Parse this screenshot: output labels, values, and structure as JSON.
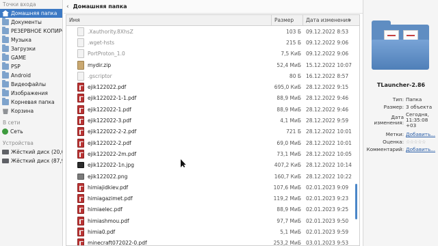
{
  "sidebar": {
    "sections": {
      "places": "Точки входа",
      "network": "В сети",
      "devices": "Устройства"
    },
    "places": [
      {
        "label": "Домашняя папка",
        "icon": "home-icon",
        "active": true
      },
      {
        "label": "Документы",
        "icon": "folder-icon"
      },
      {
        "label": "РЕЗЕРВНОЕ КОПИРОВ",
        "icon": "folder-icon"
      },
      {
        "label": "Музыка",
        "icon": "folder-icon"
      },
      {
        "label": "Загрузки",
        "icon": "folder-icon"
      },
      {
        "label": "GAME",
        "icon": "folder-icon"
      },
      {
        "label": "PSP",
        "icon": "folder-icon"
      },
      {
        "label": "Android",
        "icon": "folder-icon"
      },
      {
        "label": "Видеофайлы",
        "icon": "folder-icon"
      },
      {
        "label": "Изображения",
        "icon": "folder-icon"
      },
      {
        "label": "Корневая папка",
        "icon": "folder-icon"
      },
      {
        "label": "Корзина",
        "icon": "trash-icon"
      }
    ],
    "network": [
      {
        "label": "Сеть",
        "icon": "network-icon"
      }
    ],
    "devices": [
      {
        "label": "Жёсткий диск (20,0 Г",
        "icon": "disk-icon"
      },
      {
        "label": "Жёсткий диск (87,9 Г",
        "icon": "disk-icon"
      }
    ]
  },
  "location": {
    "back_arrow": "‹",
    "title": "Домашняя папка"
  },
  "table": {
    "columns": {
      "name": "Имя",
      "size": "Размер",
      "date": "Дата изменения",
      "sort_arrow": "▾"
    },
    "rows": [
      {
        "name": ".Xauthority.8XhsZ",
        "size": "103 Б",
        "date": "09.12.2022 8:53",
        "type": "doc",
        "hidden": true
      },
      {
        "name": ".wget-hsts",
        "size": "215 Б",
        "date": "09.12.2022 9:06",
        "type": "doc",
        "hidden": true
      },
      {
        "name": "PortProton_1.0",
        "size": "7,5 КиБ",
        "date": "09.12.2022 9:06",
        "type": "doc",
        "hidden": true
      },
      {
        "name": "mydir.zip",
        "size": "52,4 МиБ",
        "date": "15.12.2022 10:07",
        "type": "zip",
        "hidden": false
      },
      {
        "name": ".gscriptor",
        "size": "80 Б",
        "date": "16.12.2022 8:57",
        "type": "doc",
        "hidden": true
      },
      {
        "name": "ejik122022.pdf",
        "size": "695,0 КиБ",
        "date": "28.12.2022 9:15",
        "type": "pdf",
        "hidden": false
      },
      {
        "name": "ejik122022-1-1.pdf",
        "size": "88,9 МиБ",
        "date": "28.12.2022 9:46",
        "type": "pdf",
        "hidden": false
      },
      {
        "name": "ejik122022-1.pdf",
        "size": "88,9 МиБ",
        "date": "28.12.2022 9:46",
        "type": "pdf",
        "hidden": false
      },
      {
        "name": "ejik122022-3.pdf",
        "size": "4,1 МиБ",
        "date": "28.12.2022 9:59",
        "type": "pdf",
        "hidden": false
      },
      {
        "name": "ejik122022-2-2.pdf",
        "size": "721 Б",
        "date": "28.12.2022 10:01",
        "type": "pdf",
        "hidden": false
      },
      {
        "name": "ejik122022-2.pdf",
        "size": "69,0 МиБ",
        "date": "28.12.2022 10:01",
        "type": "pdf",
        "hidden": false
      },
      {
        "name": "ejik122022-2m.pdf",
        "size": "73,1 МиБ",
        "date": "28.12.2022 10:05",
        "type": "pdf",
        "hidden": false
      },
      {
        "name": "ejik122022-1n.jpg",
        "size": "407,2 КиБ",
        "date": "28.12.2022 10:14",
        "type": "img",
        "hidden": false
      },
      {
        "name": "ejik122022.png",
        "size": "160,7 КиБ",
        "date": "28.12.2022 10:22",
        "type": "png",
        "hidden": false
      },
      {
        "name": "himiajidkiev.pdf",
        "size": "107,6 МиБ",
        "date": "02.01.2023 9:09",
        "type": "pdf",
        "hidden": false
      },
      {
        "name": "himiagazimet.pdf",
        "size": "119,2 МиБ",
        "date": "02.01.2023 9:23",
        "type": "pdf",
        "hidden": false
      },
      {
        "name": "himiaelec.pdf",
        "size": "88,9 МиБ",
        "date": "02.01.2023 9:25",
        "type": "pdf",
        "hidden": false
      },
      {
        "name": "himiashmou.pdf",
        "size": "97,7 МиБ",
        "date": "02.01.2023 9:50",
        "type": "pdf",
        "hidden": false
      },
      {
        "name": "himia0.pdf",
        "size": "5,1 МиБ",
        "date": "02.01.2023 9:59",
        "type": "pdf",
        "hidden": false
      },
      {
        "name": "minecraft072022-0.pdf",
        "size": "253,2 МиБ",
        "date": "03.01.2023 9:53",
        "type": "pdf",
        "hidden": false
      }
    ]
  },
  "info": {
    "title": "TLauncher-2.86",
    "type_key": "Тип:",
    "type_val": "Папка",
    "size_key": "Размер:",
    "size_val": "3 объекта",
    "modified_key": "Дата изменения:",
    "modified_val": "Сегодня, 11:35:08 +03",
    "tags_key": "Метки:",
    "tags_val": "Добавить...",
    "rating_key": "Оценка:",
    "rating_val": "☆☆☆☆☆",
    "comment_key": "Комментарий:",
    "comment_val": "Добавить..."
  }
}
